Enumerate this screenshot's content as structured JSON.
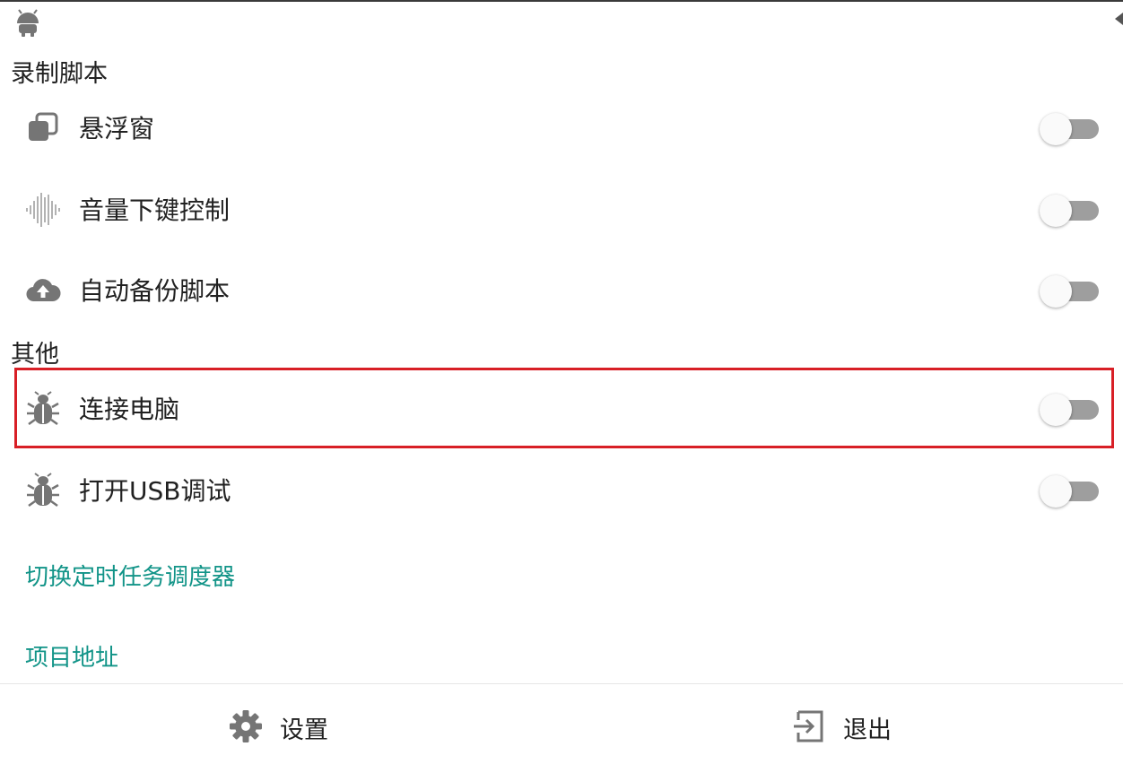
{
  "sections": {
    "record_title": "录制脚本",
    "other_title": "其他"
  },
  "record_items": [
    {
      "label": "悬浮窗",
      "icon": "floating-window-icon",
      "enabled": false
    },
    {
      "label": "音量下键控制",
      "icon": "sound-wave-icon",
      "enabled": false
    },
    {
      "label": "自动备份脚本",
      "icon": "cloud-upload-icon",
      "enabled": false
    }
  ],
  "other_items": [
    {
      "label": "连接电脑",
      "icon": "bug-icon",
      "enabled": false,
      "highlighted": true
    },
    {
      "label": "打开USB调试",
      "icon": "bug-icon",
      "enabled": false
    }
  ],
  "links": {
    "scheduler": "切换定时任务调度器",
    "project": "项目地址"
  },
  "footer": {
    "settings_label": "设置",
    "settings_icon": "gear-icon",
    "exit_label": "退出",
    "exit_icon": "exit-icon"
  },
  "colors": {
    "accent": "#129488",
    "highlight": "#d81f26",
    "icon": "#757575",
    "switch_track": "#9e9e9e"
  }
}
